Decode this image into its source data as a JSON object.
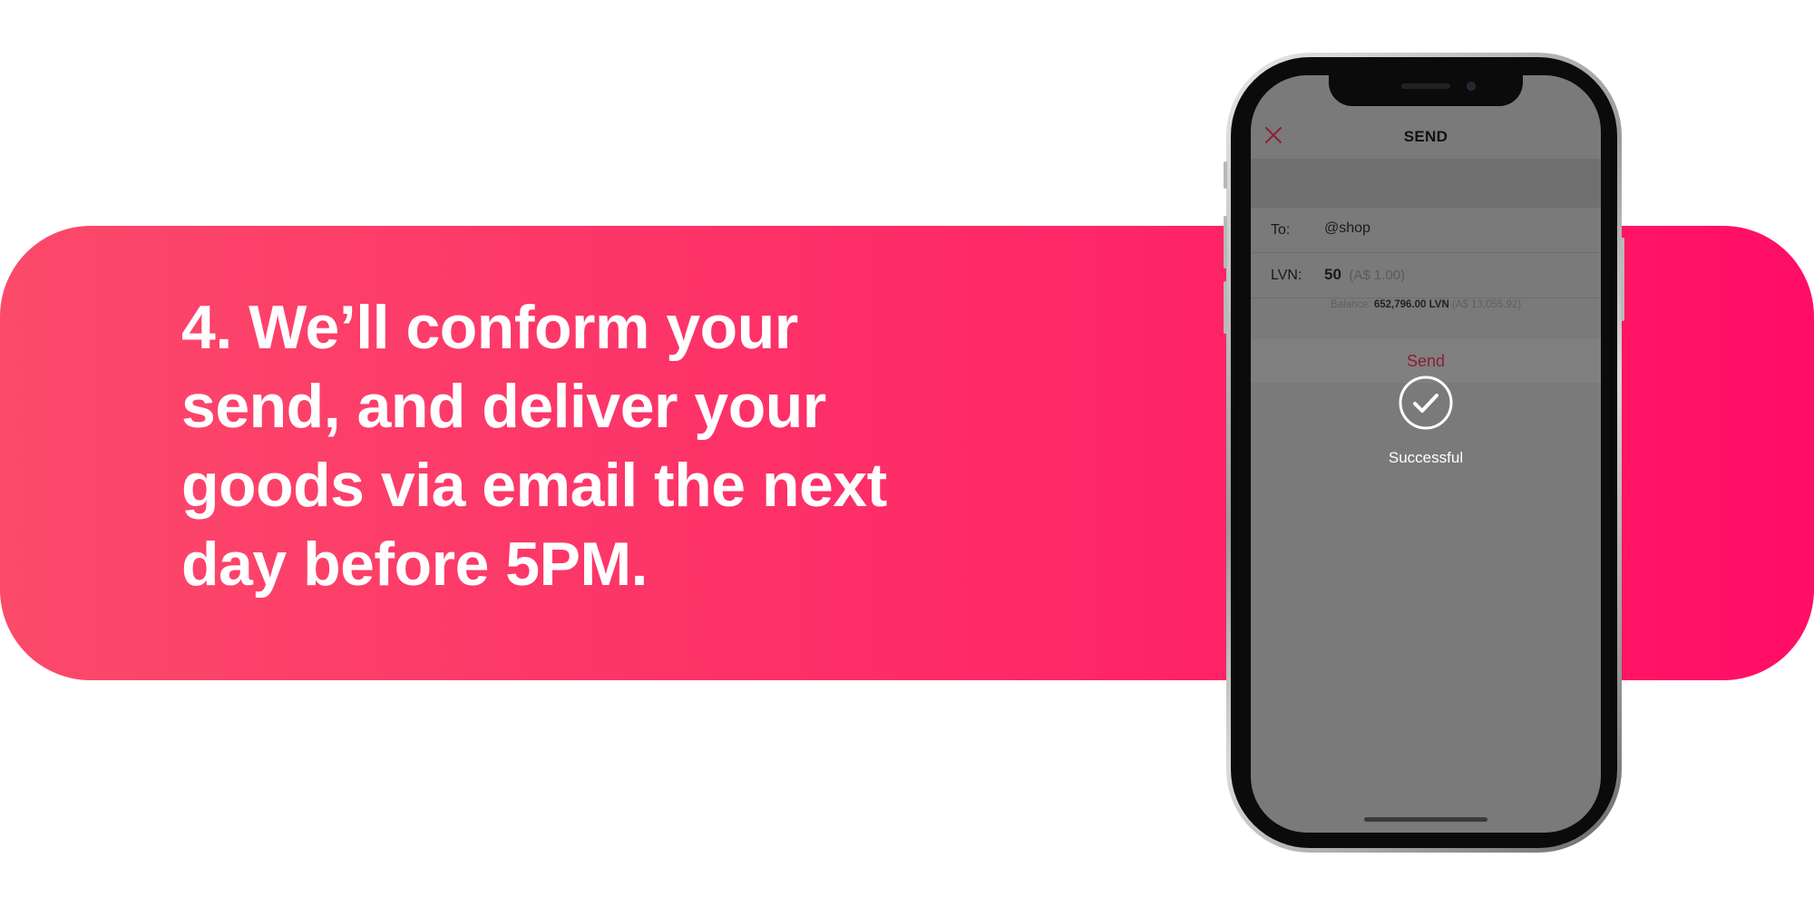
{
  "headline": {
    "lines": [
      "4. We’ll conform your",
      "send, and deliver your",
      "goods via email the next",
      "day before 5PM."
    ]
  },
  "phone": {
    "nav": {
      "title": "SEND",
      "close_icon": "close-icon"
    },
    "form": {
      "to_label": "To:",
      "to_value": "@shop",
      "amount_label": "LVN:",
      "amount_value": "50",
      "amount_fiat": "(A$ 1.00)",
      "balance_label": "Balance:",
      "balance_value": "652,796.00 LVN",
      "balance_fiat": "(A$ 13,055.92)"
    },
    "send_button": "Send",
    "status": {
      "icon": "check-circle-icon",
      "text": "Successful"
    }
  },
  "colors": {
    "banner_start": "#fb4a6a",
    "banner_end": "#ff0d66",
    "accent": "#8e1d3a",
    "overlay": "#7a7a7a"
  }
}
